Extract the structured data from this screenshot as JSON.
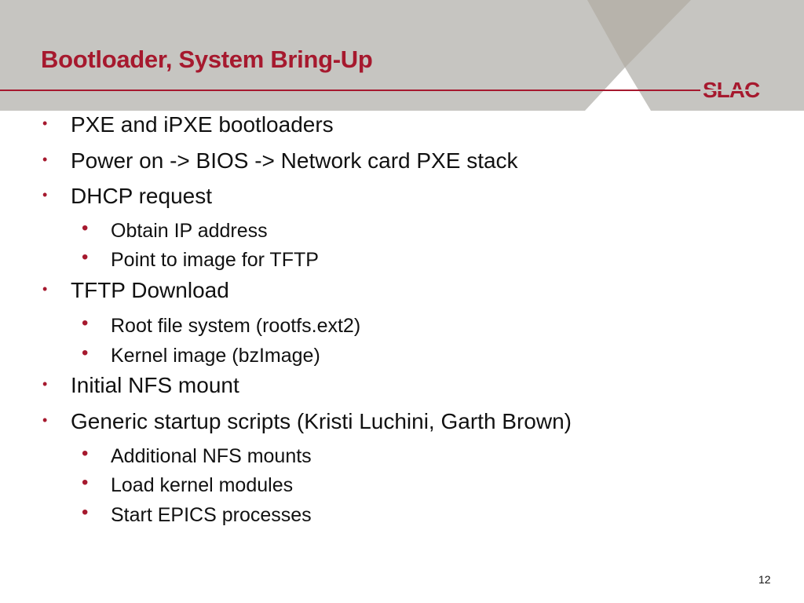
{
  "slide": {
    "title": "Bootloader, System Bring-Up",
    "logo_text": "SLAC",
    "page_number": "12",
    "accent_color": "#a6192e",
    "header_color": "#c6c5c1"
  },
  "bullets": [
    {
      "level": 1,
      "text": "PXE and iPXE bootloaders"
    },
    {
      "level": 1,
      "text": "Power on -> BIOS -> Network card PXE stack"
    },
    {
      "level": 1,
      "text": "DHCP request"
    },
    {
      "level": 2,
      "text": "Obtain IP address"
    },
    {
      "level": 2,
      "text": "Point to image for TFTP"
    },
    {
      "level": 1,
      "text": "TFTP Download"
    },
    {
      "level": 2,
      "text": "Root file system (rootfs.ext2)"
    },
    {
      "level": 2,
      "text": "Kernel image (bzImage)"
    },
    {
      "level": 1,
      "text": "Initial NFS mount"
    },
    {
      "level": 1,
      "text": "Generic startup scripts (Kristi Luchini, Garth Brown)"
    },
    {
      "level": 2,
      "text": "Additional NFS mounts"
    },
    {
      "level": 2,
      "text": "Load kernel modules"
    },
    {
      "level": 2,
      "text": "Start EPICS processes"
    }
  ],
  "bullet_glyph": "•"
}
